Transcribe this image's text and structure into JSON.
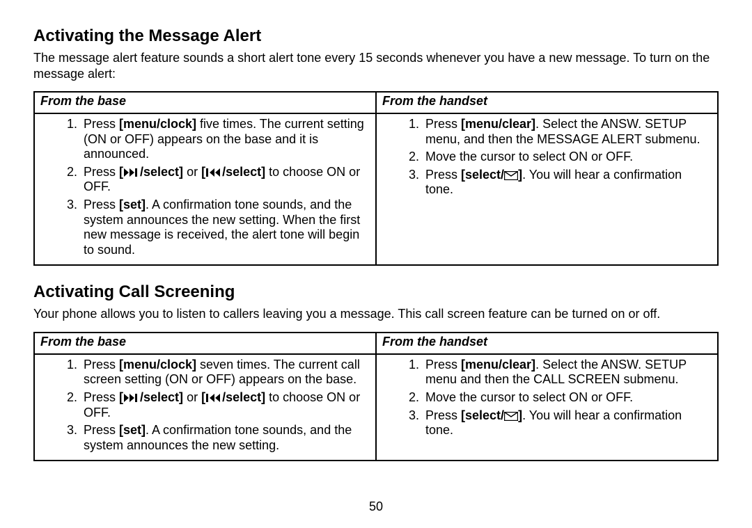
{
  "pageNumber": "50",
  "section1": {
    "title": "Activating the Message Alert",
    "intro": "The message alert feature sounds a short alert tone every 15 seconds whenever you have a new message. To turn on the message alert:",
    "cols": {
      "left": "From the base",
      "right": "From the handset"
    },
    "base": {
      "s1a": "Press ",
      "s1b": "[menu/clock]",
      "s1c": " five times. The current setting (ON or OFF) appears on the base and it is announced.",
      "s2a": "Press ",
      "s2b": "[",
      "s2c": "/select]",
      "s2d": " or ",
      "s2e": "[",
      "s2f": "/select]",
      "s2g": "  to choose ON or OFF.",
      "s3a": "Press ",
      "s3b": "[set]",
      "s3c": ". A confirmation tone sounds, and the system announces the new setting. When the first new message is received, the alert tone will begin to sound."
    },
    "handset": {
      "s1a": "Press ",
      "s1b": "[menu/clear]",
      "s1c": ". Select the ANSW. SETUP menu, and then the MESSAGE ALERT submenu.",
      "s2": "Move the cursor to select ON or OFF.",
      "s3a": "Press ",
      "s3b": "[select/",
      "s3c": "]",
      "s3d": ". You will hear a confirmation tone."
    }
  },
  "section2": {
    "title": "Activating Call Screening",
    "intro": "Your phone allows you to listen to callers leaving you a message. This call screen feature can be turned on or off.",
    "cols": {
      "left": "From the base",
      "right": "From the handset"
    },
    "base": {
      "s1a": "Press ",
      "s1b": "[menu/clock]",
      "s1c": " seven times. The current call screen setting (ON or OFF) appears on the base.",
      "s2a": "Press ",
      "s2b": "[",
      "s2c": "/select]",
      "s2d": " or ",
      "s2e": "[",
      "s2f": "/select]",
      "s2g": "  to choose ON or OFF.",
      "s3a": "Press ",
      "s3b": "[set]",
      "s3c": ". A confirmation tone sounds, and the system announces the new setting."
    },
    "handset": {
      "s1a": "Press ",
      "s1b": "[menu/clear]",
      "s1c": ". Select the ANSW. SETUP menu and then the CALL SCREEN submenu.",
      "s2": "Move the cursor to select ON or OFF.",
      "s3a": "Press ",
      "s3b": "[select/",
      "s3c": "]",
      "s3d": ". You will hear a confirmation tone."
    }
  }
}
